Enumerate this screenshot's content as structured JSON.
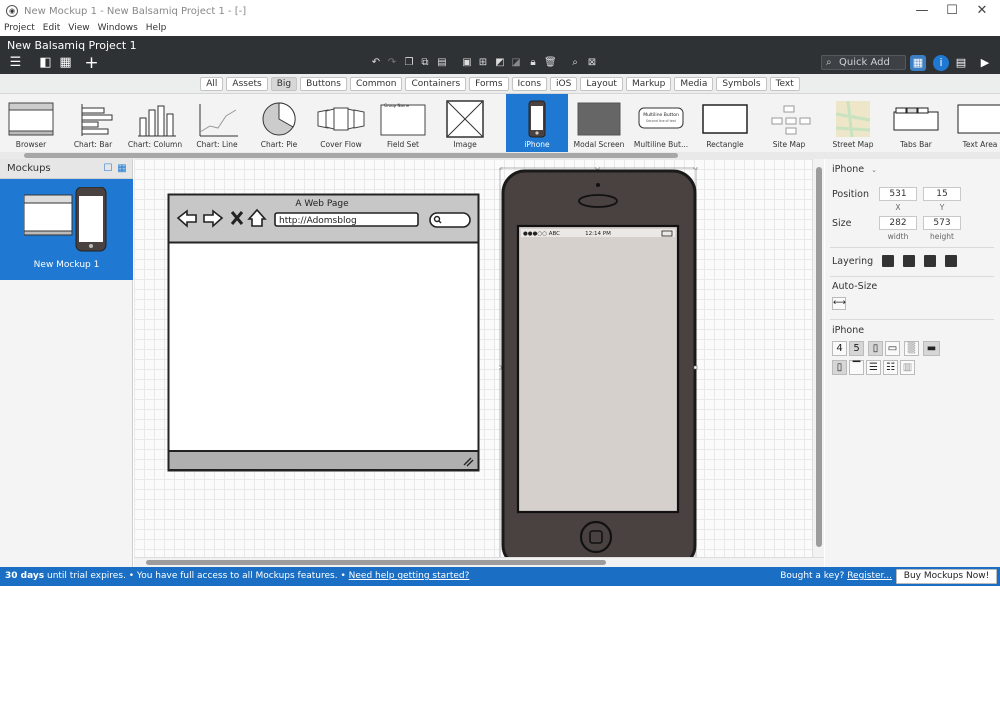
{
  "window": {
    "title": "New Mockup 1 - New Balsamiq Project 1 - [-]",
    "controls": {
      "minimize": "—",
      "maximize": "☐",
      "close": "✕"
    }
  },
  "menu": [
    "Project",
    "Edit",
    "View",
    "Windows",
    "Help"
  ],
  "header": {
    "project_title": "New Balsamiq Project 1",
    "quick_add_placeholder": "Quick Add"
  },
  "categories": [
    "All",
    "Assets",
    "Big",
    "Buttons",
    "Common",
    "Containers",
    "Forms",
    "Icons",
    "iOS",
    "Layout",
    "Markup",
    "Media",
    "Symbols",
    "Text"
  ],
  "active_category": "Big",
  "library": [
    "Browser",
    "Chart: Bar",
    "Chart: Column",
    "Chart: Line",
    "Chart: Pie",
    "Cover Flow",
    "Field Set",
    "Image",
    "iPhone",
    "Modal Screen",
    "Multiline But...",
    "Rectangle",
    "Site Map",
    "Street Map",
    "Tabs Bar",
    "Text Area"
  ],
  "library_selected": "iPhone",
  "library_thumb_text": {
    "field_set": "Group Name",
    "multiline_title": "Multiline Button",
    "multiline_sub": "Second line of text"
  },
  "mockups_panel": {
    "title": "Mockups",
    "items": [
      {
        "label": "New Mockup 1"
      }
    ]
  },
  "canvas": {
    "browser": {
      "title": "A Web Page",
      "url": "http://Adomsblog"
    },
    "iphone": {
      "carrier": "●●●○○ ABC",
      "time": "12:14 PM"
    }
  },
  "properties": {
    "component": "iPhone",
    "position_label": "Position",
    "x": "531",
    "y": "15",
    "x_label": "X",
    "y_label": "Y",
    "size_label": "Size",
    "width": "282",
    "height": "573",
    "width_label": "width",
    "height_label": "height",
    "layering_label": "Layering",
    "autosize_label": "Auto-Size",
    "iphone_label": "iPhone",
    "version_options": [
      "4",
      "5"
    ]
  },
  "trial": {
    "days": "30 days",
    "message": " until trial expires. • You have full access to all Mockups features. • ",
    "help_link": "Need help getting started?",
    "key_question": "Bought a key? ",
    "register_link": "Register...",
    "buy_button": "Buy Mockups Now!"
  },
  "colors": {
    "accent_blue": "#1f78d1",
    "header_dark": "#2f3235",
    "trial_bar": "#1a6fc4",
    "phone_body": "#4a4241",
    "phone_screen": "#d6d0cd"
  }
}
